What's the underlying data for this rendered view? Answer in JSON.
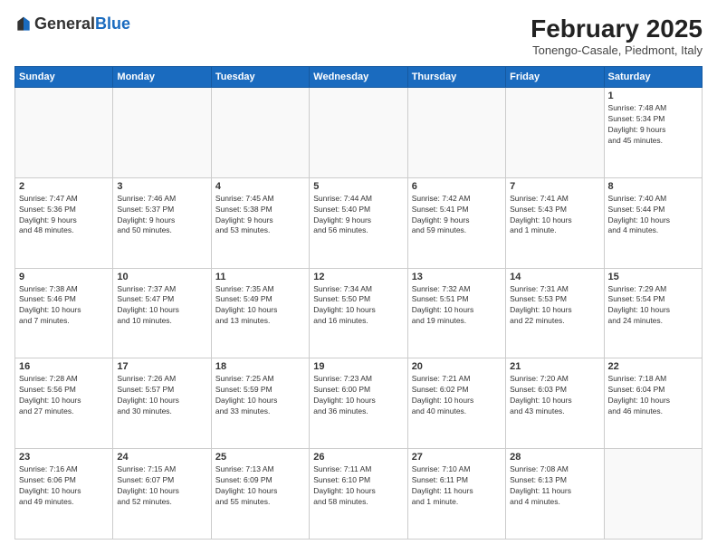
{
  "header": {
    "logo": {
      "general": "General",
      "blue": "Blue"
    },
    "title": "February 2025",
    "location": "Tonengo-Casale, Piedmont, Italy"
  },
  "calendar": {
    "weekdays": [
      "Sunday",
      "Monday",
      "Tuesday",
      "Wednesday",
      "Thursday",
      "Friday",
      "Saturday"
    ],
    "weeks": [
      [
        {
          "day": "",
          "info": ""
        },
        {
          "day": "",
          "info": ""
        },
        {
          "day": "",
          "info": ""
        },
        {
          "day": "",
          "info": ""
        },
        {
          "day": "",
          "info": ""
        },
        {
          "day": "",
          "info": ""
        },
        {
          "day": "1",
          "info": "Sunrise: 7:48 AM\nSunset: 5:34 PM\nDaylight: 9 hours\nand 45 minutes."
        }
      ],
      [
        {
          "day": "2",
          "info": "Sunrise: 7:47 AM\nSunset: 5:36 PM\nDaylight: 9 hours\nand 48 minutes."
        },
        {
          "day": "3",
          "info": "Sunrise: 7:46 AM\nSunset: 5:37 PM\nDaylight: 9 hours\nand 50 minutes."
        },
        {
          "day": "4",
          "info": "Sunrise: 7:45 AM\nSunset: 5:38 PM\nDaylight: 9 hours\nand 53 minutes."
        },
        {
          "day": "5",
          "info": "Sunrise: 7:44 AM\nSunset: 5:40 PM\nDaylight: 9 hours\nand 56 minutes."
        },
        {
          "day": "6",
          "info": "Sunrise: 7:42 AM\nSunset: 5:41 PM\nDaylight: 9 hours\nand 59 minutes."
        },
        {
          "day": "7",
          "info": "Sunrise: 7:41 AM\nSunset: 5:43 PM\nDaylight: 10 hours\nand 1 minute."
        },
        {
          "day": "8",
          "info": "Sunrise: 7:40 AM\nSunset: 5:44 PM\nDaylight: 10 hours\nand 4 minutes."
        }
      ],
      [
        {
          "day": "9",
          "info": "Sunrise: 7:38 AM\nSunset: 5:46 PM\nDaylight: 10 hours\nand 7 minutes."
        },
        {
          "day": "10",
          "info": "Sunrise: 7:37 AM\nSunset: 5:47 PM\nDaylight: 10 hours\nand 10 minutes."
        },
        {
          "day": "11",
          "info": "Sunrise: 7:35 AM\nSunset: 5:49 PM\nDaylight: 10 hours\nand 13 minutes."
        },
        {
          "day": "12",
          "info": "Sunrise: 7:34 AM\nSunset: 5:50 PM\nDaylight: 10 hours\nand 16 minutes."
        },
        {
          "day": "13",
          "info": "Sunrise: 7:32 AM\nSunset: 5:51 PM\nDaylight: 10 hours\nand 19 minutes."
        },
        {
          "day": "14",
          "info": "Sunrise: 7:31 AM\nSunset: 5:53 PM\nDaylight: 10 hours\nand 22 minutes."
        },
        {
          "day": "15",
          "info": "Sunrise: 7:29 AM\nSunset: 5:54 PM\nDaylight: 10 hours\nand 24 minutes."
        }
      ],
      [
        {
          "day": "16",
          "info": "Sunrise: 7:28 AM\nSunset: 5:56 PM\nDaylight: 10 hours\nand 27 minutes."
        },
        {
          "day": "17",
          "info": "Sunrise: 7:26 AM\nSunset: 5:57 PM\nDaylight: 10 hours\nand 30 minutes."
        },
        {
          "day": "18",
          "info": "Sunrise: 7:25 AM\nSunset: 5:59 PM\nDaylight: 10 hours\nand 33 minutes."
        },
        {
          "day": "19",
          "info": "Sunrise: 7:23 AM\nSunset: 6:00 PM\nDaylight: 10 hours\nand 36 minutes."
        },
        {
          "day": "20",
          "info": "Sunrise: 7:21 AM\nSunset: 6:02 PM\nDaylight: 10 hours\nand 40 minutes."
        },
        {
          "day": "21",
          "info": "Sunrise: 7:20 AM\nSunset: 6:03 PM\nDaylight: 10 hours\nand 43 minutes."
        },
        {
          "day": "22",
          "info": "Sunrise: 7:18 AM\nSunset: 6:04 PM\nDaylight: 10 hours\nand 46 minutes."
        }
      ],
      [
        {
          "day": "23",
          "info": "Sunrise: 7:16 AM\nSunset: 6:06 PM\nDaylight: 10 hours\nand 49 minutes."
        },
        {
          "day": "24",
          "info": "Sunrise: 7:15 AM\nSunset: 6:07 PM\nDaylight: 10 hours\nand 52 minutes."
        },
        {
          "day": "25",
          "info": "Sunrise: 7:13 AM\nSunset: 6:09 PM\nDaylight: 10 hours\nand 55 minutes."
        },
        {
          "day": "26",
          "info": "Sunrise: 7:11 AM\nSunset: 6:10 PM\nDaylight: 10 hours\nand 58 minutes."
        },
        {
          "day": "27",
          "info": "Sunrise: 7:10 AM\nSunset: 6:11 PM\nDaylight: 11 hours\nand 1 minute."
        },
        {
          "day": "28",
          "info": "Sunrise: 7:08 AM\nSunset: 6:13 PM\nDaylight: 11 hours\nand 4 minutes."
        },
        {
          "day": "",
          "info": ""
        }
      ]
    ]
  }
}
